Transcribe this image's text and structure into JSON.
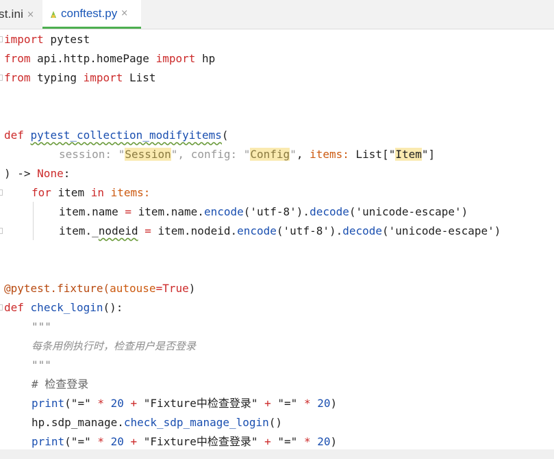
{
  "tabs": [
    {
      "label": "st.ini",
      "close": "×",
      "active": false
    },
    {
      "label": "conftest.py",
      "close": "×",
      "active": true
    }
  ],
  "code": {
    "l1": {
      "kw": "import",
      "rest": " pytest"
    },
    "l2": {
      "kw": "from",
      "mod": " api.http.homePage ",
      "kw2": "import",
      "rest": " hp"
    },
    "l3": {
      "kw": "from",
      "mod": " typing ",
      "kw2": "import",
      "rest": " List"
    },
    "l4": {
      "kw": "def",
      "name": "pytest_collection_modifyitems",
      "tail": "("
    },
    "l5": {
      "p1": "session: ",
      "q1": "\"",
      "t1": "Session",
      "q1b": "\"",
      "c1": ", ",
      "p2": "config: ",
      "q2": "\"",
      "t2": "Config",
      "q2b": "\"",
      "c2": ", ",
      "p3": "items:",
      "sp": " ",
      "t3pre": "List[\"",
      "t3": "Item",
      "t3post": "\"]"
    },
    "l6": {
      "pre": ") -> ",
      "none": "None",
      "colon": ":"
    },
    "l7": {
      "kw": "for",
      "mid": " item ",
      "kw2": "in",
      "rest": " items:"
    },
    "l8": {
      "a": "item.name ",
      "eq": "=",
      "b": " item.name.",
      "enc": "encode",
      "c": "('utf-8').",
      "dec": "decode",
      "d": "('unicode-escape')"
    },
    "l9": {
      "a": "item._",
      "nodeid": "nodeid",
      "sp": " ",
      "eq": "=",
      "b": " item.nodeid.",
      "enc": "encode",
      "c": "('utf-8').",
      "dec": "decode",
      "d": "('unicode-escape')"
    },
    "l10": {
      "at": "@pytest.fixture(",
      "arg": "autouse",
      "eq": "=",
      "val": "True",
      "close": ")"
    },
    "l11": {
      "kw": "def",
      "sp": " ",
      "name": "check_login",
      "tail": "():"
    },
    "l12": {
      "text": "\"\"\""
    },
    "l13": {
      "text": "每条用例执行时，检查用户是否登录"
    },
    "l14": {
      "text": "\"\"\""
    },
    "l15": {
      "text": "# 检查登录"
    },
    "l16": {
      "print": "print",
      "p1": "(\"=\" ",
      "star": "*",
      "n": " 20",
      "plus": " +",
      "s": " \"Fixture中检查登录\"",
      "plus2": " +",
      "s2": " \"=\" ",
      "star2": "*",
      "n2": " 20",
      "close": ")"
    },
    "l17": {
      "a": "hp.sdp_manage.",
      "fn": "check_sdp_manage_login",
      "b": "()"
    },
    "l18": {
      "print": "print",
      "p1": "(\"=\" ",
      "star": "*",
      "n": " 20",
      "plus": " +",
      "s": " \"Fixture中检查登录\"",
      "plus2": " +",
      "s2": " \"=\" ",
      "star2": "*",
      "n2": " 20",
      "close": ")"
    }
  }
}
